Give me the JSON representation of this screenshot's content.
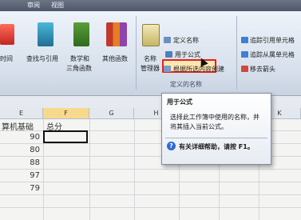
{
  "ribbon_tabs": [
    "审阅",
    "视图"
  ],
  "function_library": {
    "buttons": [
      {
        "label": "时间",
        "icon": "calendar-clock-icon"
      },
      {
        "label": "查找与引用",
        "icon": "lookup-reference-icon"
      },
      {
        "label": "数学和",
        "label2": "三角函数",
        "icon": "math-trig-icon"
      },
      {
        "label": "其他函数",
        "icon": "more-functions-icon"
      }
    ]
  },
  "defined_names": {
    "name_manager_line1": "名称",
    "name_manager_line2": "管理器",
    "define_name": "定义名称",
    "use_in_formula": "用于公式",
    "create_from_selection": "根据所选内容创建",
    "group_label": "定义的名称"
  },
  "formula_auditing": {
    "trace_precedents": "追踪引用单元格",
    "trace_dependents": "追踪从属单元格",
    "remove_arrows": "移去箭头"
  },
  "tooltip": {
    "title": "用于公式",
    "description": "选择此工作簿中使用的名称，并将其插入当前公式。",
    "help": "有关详细帮助，请按 F1。"
  },
  "sheet": {
    "columns": [
      "E",
      "F",
      "G",
      "H",
      "I",
      "J",
      "K"
    ],
    "header_e": "算机基础",
    "header_f": "总分",
    "values": [
      "90",
      "80",
      "88",
      "97",
      "79"
    ]
  },
  "colors": {
    "highlight": "#e0231e",
    "selected_column": "#f6d98c",
    "help_icon": "#2d6bd3"
  }
}
